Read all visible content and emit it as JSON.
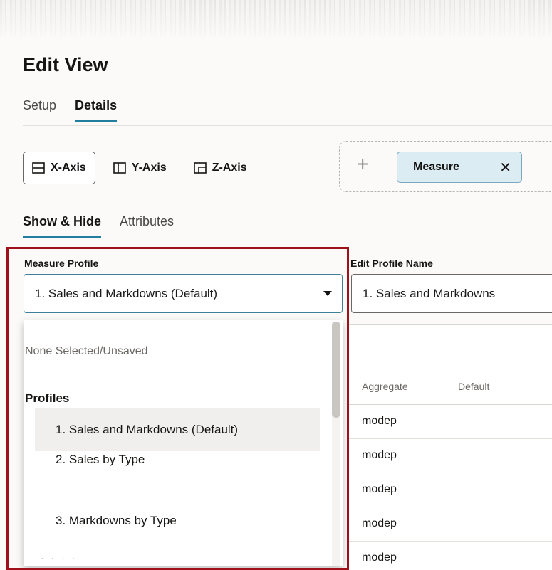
{
  "page": {
    "title": "Edit View"
  },
  "tabs": [
    {
      "label": "Setup",
      "active": false
    },
    {
      "label": "Details",
      "active": true
    }
  ],
  "axes": [
    {
      "label": "X-Axis",
      "icon": "x-axis-icon",
      "selected": true
    },
    {
      "label": "Y-Axis",
      "icon": "y-axis-icon",
      "selected": false
    },
    {
      "label": "Z-Axis",
      "icon": "z-axis-icon",
      "selected": false
    }
  ],
  "drop_area": {
    "add_icon": "plus-icon",
    "chip_label": "Measure",
    "chip_close": "✕"
  },
  "subtabs": [
    {
      "label": "Show & Hide",
      "active": true
    },
    {
      "label": "Attributes",
      "active": false
    }
  ],
  "measure_profile": {
    "label": "Measure Profile",
    "value": "1. Sales and Markdowns (Default)"
  },
  "edit_profile_name": {
    "label": "Edit Profile Name",
    "value": "1. Sales and Markdowns"
  },
  "dropdown": {
    "none_label": "None Selected/Unsaved",
    "group_label": "Profiles",
    "items": [
      {
        "label": "1. Sales and Markdowns (Default)",
        "active": true
      },
      {
        "label": "2. Sales by Type",
        "active": false
      },
      {
        "label": "3. Markdowns by Type",
        "active": false
      }
    ],
    "more": "· · · ·"
  },
  "table": {
    "columns": [
      "Aggregate",
      "Default"
    ],
    "rows": [
      "modep",
      "modep",
      "modep",
      "modep",
      "modep"
    ]
  },
  "colors": {
    "accent": "#227e9e",
    "highlight": "#a0101b",
    "chip_bg": "#dcecf3"
  }
}
